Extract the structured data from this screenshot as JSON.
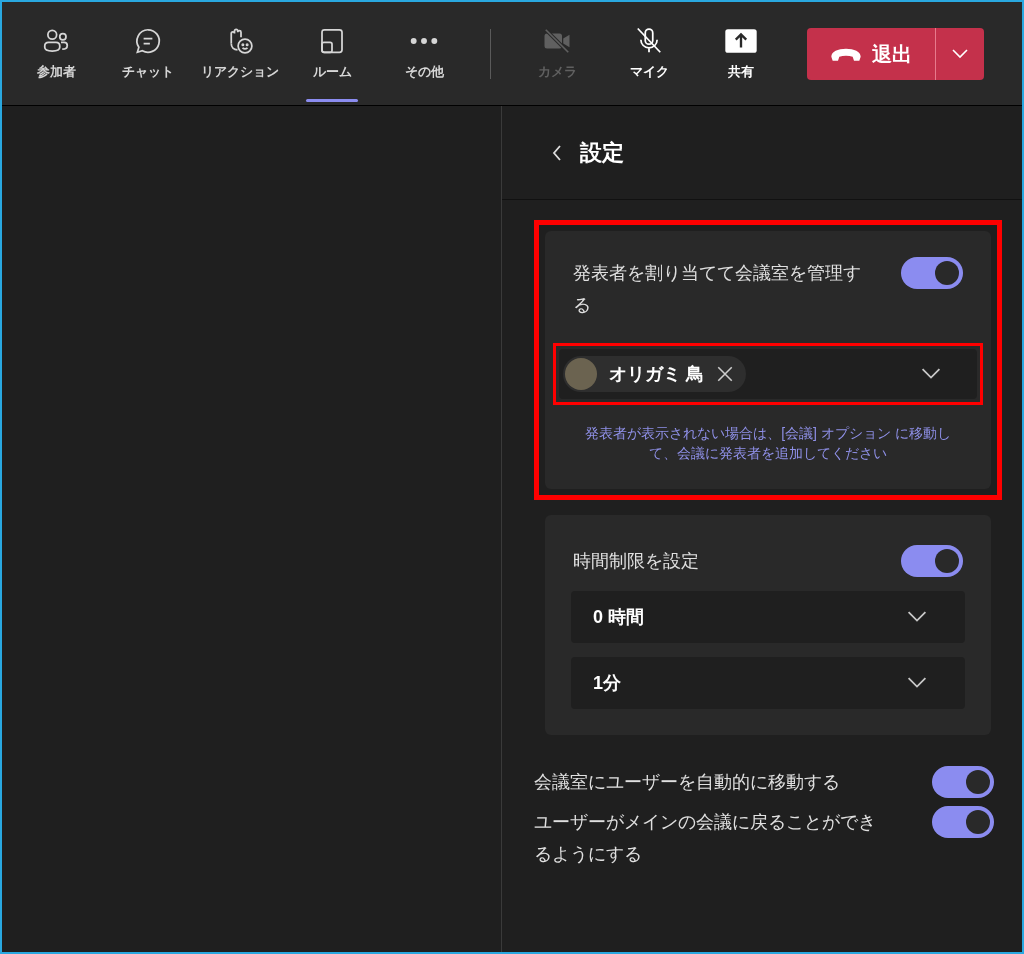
{
  "toolbar": {
    "items": [
      {
        "kind": "people",
        "label": "参加者",
        "selected": false,
        "disabled": false
      },
      {
        "kind": "chat",
        "label": "チャット",
        "selected": false,
        "disabled": false
      },
      {
        "kind": "reaction",
        "label": "リアクション",
        "selected": false,
        "disabled": false
      },
      {
        "kind": "rooms",
        "label": "ルーム",
        "selected": true,
        "disabled": false
      },
      {
        "kind": "more",
        "label": "その他",
        "selected": false,
        "disabled": false
      }
    ],
    "devices": [
      {
        "kind": "camera",
        "label": "カメラ",
        "disabled": true
      },
      {
        "kind": "mic",
        "label": "マイク",
        "disabled": false
      },
      {
        "kind": "share",
        "label": "共有",
        "disabled": false
      }
    ],
    "leave_button": {
      "label": "退出"
    }
  },
  "panel": {
    "title": "設定",
    "presenter_card": {
      "highlighted": true,
      "label": "発表者を割り当てて会議室を管理する",
      "on": true,
      "picker": {
        "highlighted": true,
        "chips": [
          {
            "name": "オリガミ 鳥"
          }
        ]
      },
      "hint": "発表者が表示されない場合は、[会議] オプション に移動して、会議に発表者を追加してください"
    },
    "time_card": {
      "highlighted": false,
      "label": "時間制限を設定",
      "on": true,
      "dropdowns": [
        {
          "value": "0 時間"
        },
        {
          "value": "1分"
        }
      ]
    },
    "options": [
      {
        "label": "会議室にユーザーを自動的に移動する",
        "on": true
      },
      {
        "label": "ユーザーがメインの会議に戻ることができるようにする",
        "on": true
      }
    ]
  }
}
